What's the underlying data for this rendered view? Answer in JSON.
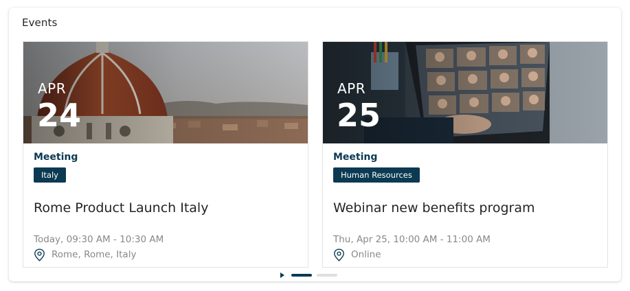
{
  "panel": {
    "title": "Events"
  },
  "events": [
    {
      "month": "APR",
      "day": "24",
      "type": "Meeting",
      "tag": "Italy",
      "title": "Rome Product Launch Italy",
      "time": "Today, 09:30 AM - 10:30 AM",
      "location": "Rome, Rome, Italy"
    },
    {
      "month": "APR",
      "day": "25",
      "type": "Meeting",
      "tag": "Human Resources",
      "title": "Webinar new benefits program",
      "time": "Thu, Apr 25, 10:00 AM - 11:00 AM",
      "location": "Online"
    }
  ],
  "pager": {
    "pages": 2,
    "current": 1
  },
  "colors": {
    "accent": "#0b3a52",
    "muted": "#8a8886"
  }
}
